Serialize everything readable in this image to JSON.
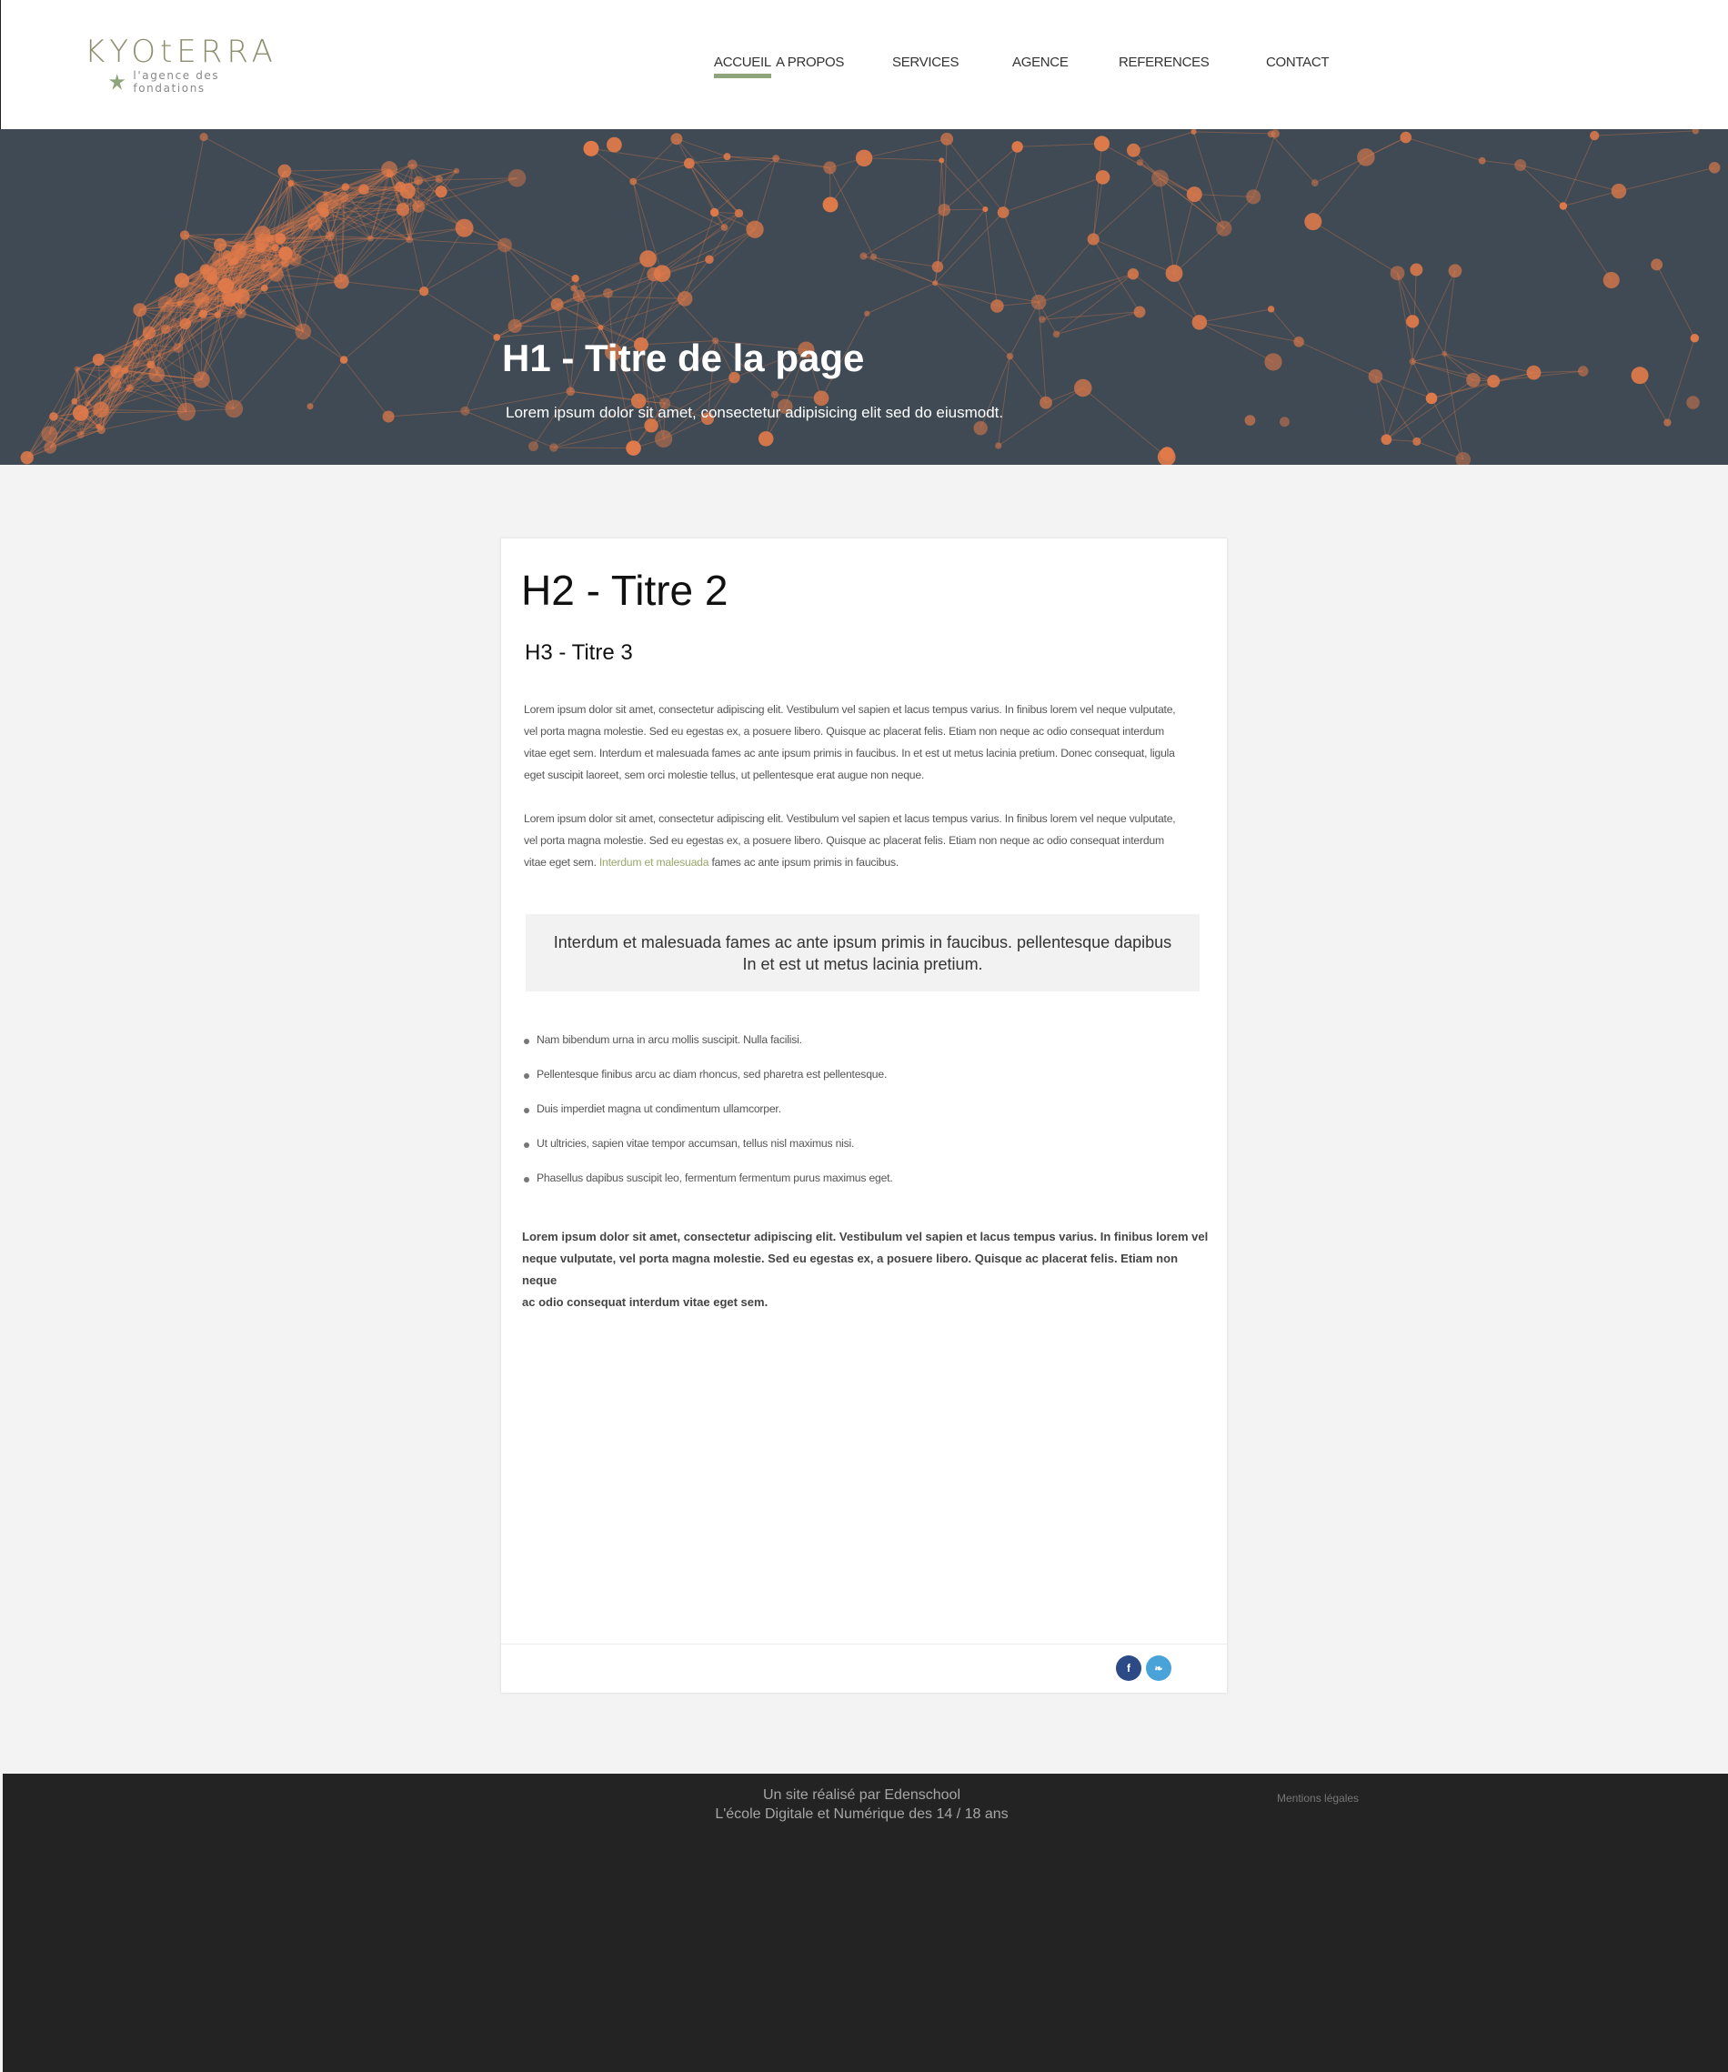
{
  "brand": {
    "name": "KYOtERRA",
    "tagline": "l'agence des fondations",
    "accent_color": "#8ea47a"
  },
  "nav": {
    "items": [
      {
        "label": "ACCUEIL",
        "active": true
      },
      {
        "label": "A PROPOS",
        "active": false
      },
      {
        "label": "SERVICES",
        "active": false
      },
      {
        "label": "AGENCE",
        "active": false
      },
      {
        "label": "REFERENCES",
        "active": false
      },
      {
        "label": "CONTACT",
        "active": false
      }
    ]
  },
  "hero": {
    "title": "H1 - Titre de la page",
    "subtitle": "Lorem ipsum dolor sit amet, consectetur adipisicing elit sed do eiusmodt.",
    "background_color": "#3f4a54",
    "node_color": "#e07a4a"
  },
  "content": {
    "h2": "H2 - Titre 2",
    "h3": "H3 - Titre 3",
    "paragraph1": {
      "lines": [
        "Lorem ipsum dolor sit amet, consectetur adipiscing elit. Vestibulum vel sapien et lacus tempus varius. In finibus lorem vel neque vulputate,",
        "vel porta magna molestie. Sed eu egestas ex, a posuere libero. Quisque ac placerat felis. Etiam non neque ac odio consequat interdum",
        "vitae eget sem. Interdum et malesuada fames ac ante ipsum primis in faucibus. In et est ut metus lacinia pretium. Donec consequat, ligula",
        "eget suscipit laoreet, sem orci molestie tellus, ut pellentesque erat augue non neque."
      ]
    },
    "paragraph2": {
      "line1": "Lorem ipsum dolor sit amet, consectetur adipiscing elit. Vestibulum vel sapien et lacus tempus varius. In finibus lorem vel neque vulputate,",
      "line2": "vel porta magna molestie. Sed eu egestas ex, a posuere libero. Quisque ac placerat felis. Etiam non neque ac odio consequat interdum",
      "line3_before": "vitae eget sem. ",
      "link": "Interdum et malesuada",
      "line3_after": " fames ac ante ipsum primis in faucibus.",
      "link_color": "#9aa66b"
    },
    "quote": {
      "line1": "Interdum et malesuada fames ac ante ipsum primis in faucibus. pellentesque dapibus",
      "line2": "In et est ut metus lacinia pretium."
    },
    "list": [
      "Nam bibendum urna in arcu mollis suscipit. Nulla facilisi.",
      "Pellentesque finibus arcu ac diam rhoncus, sed pharetra est pellentesque.",
      "Duis imperdiet magna ut condimentum ullamcorper.",
      "Ut ultricies, sapien vitae tempor accumsan, tellus nisl maximus nisi.",
      "Phasellus dapibus suscipit leo, fermentum fermentum purus maximus eget."
    ],
    "bold_paragraph": {
      "lines": [
        "Lorem ipsum dolor sit amet, consectetur adipiscing elit. Vestibulum vel sapien et lacus tempus varius. In finibus lorem vel",
        "neque vulputate, vel porta magna molestie. Sed eu egestas ex, a posuere libero. Quisque ac placerat felis. Etiam non neque",
        "ac odio consequat interdum vitae eget sem."
      ]
    },
    "social": [
      {
        "icon": "facebook-icon",
        "glyph": "f",
        "color": "#2c4a86"
      },
      {
        "icon": "twitter-icon",
        "glyph": "❧",
        "color": "#4aa3d8"
      }
    ]
  },
  "footer": {
    "credit_line1": "Un site réalisé par Edenschool",
    "credit_line2": "L'école Digitale et Numérique des 14 / 18 ans",
    "legal": "Mentions légales"
  }
}
